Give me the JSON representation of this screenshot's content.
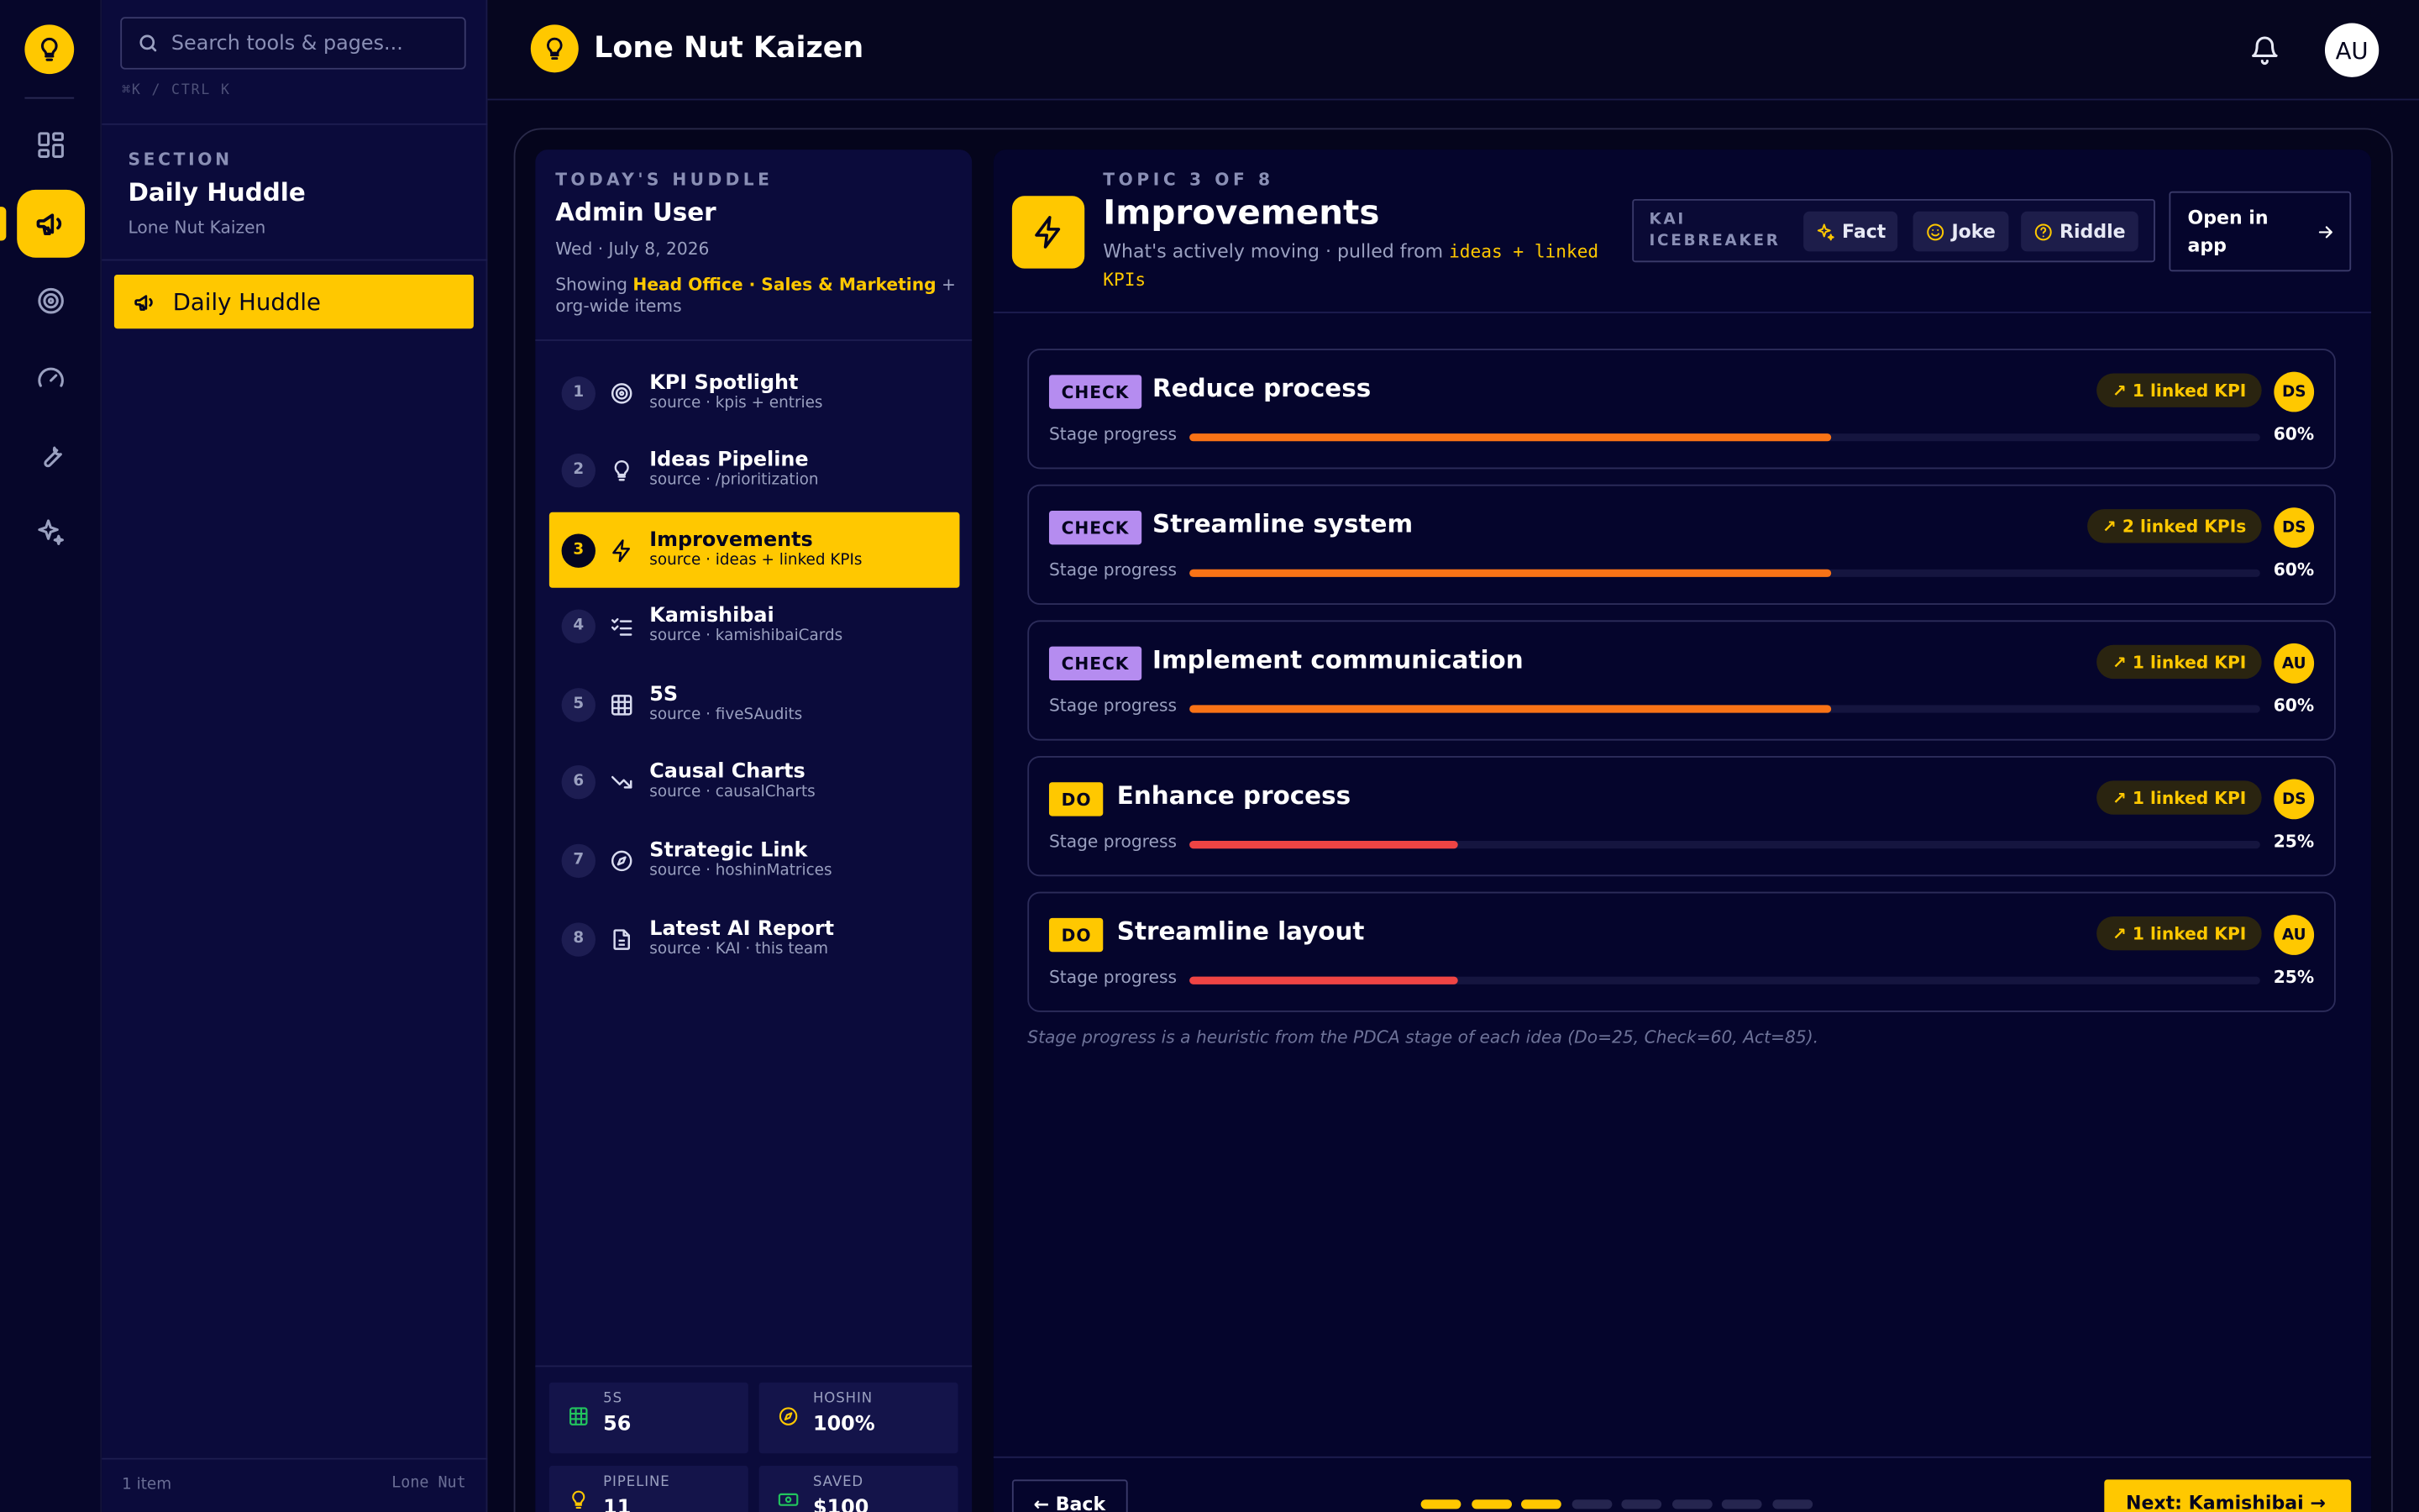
{
  "app": {
    "brand": "Lone Nut Kaizen",
    "avatar_initials": "AU"
  },
  "search": {
    "placeholder": "Search tools & pages...",
    "shortcut": "⌘K / CTRL K"
  },
  "rail": {
    "items": [
      "dashboard-icon",
      "megaphone-icon",
      "target-icon",
      "gauge-icon",
      "wrench-icon",
      "sparkles-icon"
    ],
    "active_index": 1
  },
  "sidebar": {
    "section_label": "SECTION",
    "section_title": "Daily Huddle",
    "section_subtitle": "Lone Nut Kaizen",
    "items": [
      {
        "label": "Daily Huddle",
        "icon": "megaphone-icon"
      }
    ],
    "footer_count": "1 item",
    "footer_brand": "Lone Nut"
  },
  "huddle": {
    "label": "TODAY'S HUDDLE",
    "user": "Admin User",
    "date": "Wed · July 8, 2026",
    "showing_prefix": "Showing",
    "showing_highlight": "Head Office · Sales & Marketing",
    "showing_suffix": "+ org-wide items",
    "topics": [
      {
        "num": "1",
        "title": "KPI Spotlight",
        "source": "source · kpis + entries",
        "icon": "target-icon"
      },
      {
        "num": "2",
        "title": "Ideas Pipeline",
        "source": "source · /prioritization",
        "icon": "lightbulb-icon"
      },
      {
        "num": "3",
        "title": "Improvements",
        "source": "source · ideas + linked KPIs",
        "icon": "lightning-icon"
      },
      {
        "num": "4",
        "title": "Kamishibai",
        "source": "source · kamishibaiCards",
        "icon": "checklist-icon"
      },
      {
        "num": "5",
        "title": "5S",
        "source": "source · fiveSAudits",
        "icon": "grid-icon"
      },
      {
        "num": "6",
        "title": "Causal Charts",
        "source": "source · causalCharts",
        "icon": "trend-down-icon"
      },
      {
        "num": "7",
        "title": "Strategic Link",
        "source": "source · hoshinMatrices",
        "icon": "compass-icon"
      },
      {
        "num": "8",
        "title": "Latest AI Report",
        "source": "source · KAI · this team",
        "icon": "document-icon"
      }
    ],
    "active_topic": 3,
    "stats": [
      {
        "label": "5S",
        "value": "56",
        "icon": "grid-icon",
        "color": "#22c55e"
      },
      {
        "label": "HOSHIN",
        "value": "100%",
        "icon": "compass-icon",
        "color": "#ffc800"
      },
      {
        "label": "PIPELINE",
        "value": "11",
        "icon": "lightbulb-icon",
        "color": "#ffc800"
      },
      {
        "label": "SAVED",
        "value": "$100",
        "icon": "money-icon",
        "color": "#22c55e"
      }
    ]
  },
  "topic": {
    "counter": "TOPIC 3 OF 8",
    "title": "Improvements",
    "subtitle_prefix": "What's actively moving · pulled from",
    "subtitle_source": "ideas + linked KPIs",
    "icebreaker_label": "KAI ICEBREAKER",
    "icebreaker_buttons": [
      {
        "label": "Fact",
        "icon": "sparkle-icon"
      },
      {
        "label": "Joke",
        "icon": "smile-icon"
      },
      {
        "label": "Riddle",
        "icon": "question-icon"
      }
    ],
    "open_in_app": "Open in app",
    "stage_label": "Stage progress",
    "cards": [
      {
        "stage": "CHECK",
        "title": "Reduce process",
        "kpi": "↗ 1 linked KPI",
        "owner": "DS",
        "progress": 60,
        "progress_text": "60%"
      },
      {
        "stage": "CHECK",
        "title": "Streamline system",
        "kpi": "↗ 2 linked KPIs",
        "owner": "DS",
        "progress": 60,
        "progress_text": "60%"
      },
      {
        "stage": "CHECK",
        "title": "Implement communication",
        "kpi": "↗ 1 linked KPI",
        "owner": "AU",
        "progress": 60,
        "progress_text": "60%"
      },
      {
        "stage": "DO",
        "title": "Enhance process",
        "kpi": "↗ 1 linked KPI",
        "owner": "DS",
        "progress": 25,
        "progress_text": "25%"
      },
      {
        "stage": "DO",
        "title": "Streamline layout",
        "kpi": "↗ 1 linked KPI",
        "owner": "AU",
        "progress": 25,
        "progress_text": "25%"
      }
    ],
    "note": "Stage progress is a heuristic from the PDCA stage of each idea (Do=25, Check=60, Act=85).",
    "back_label": "← Back",
    "next_label": "Next: Kamishibai →",
    "pager": {
      "total": 8,
      "current": 3
    }
  },
  "colors": {
    "accent": "#ffc800",
    "check": "#b58cf0",
    "progress_check": "#f97316",
    "progress_do": "#ef4444",
    "background": "#05051f"
  }
}
